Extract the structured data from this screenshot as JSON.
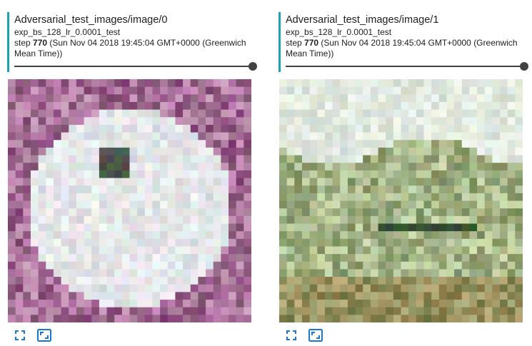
{
  "accent_color": "#1ba3b5",
  "cards": [
    {
      "title": "Adversarial_test_images/image/0",
      "run": "exp_bs_128_lr_0.0001_test",
      "step_prefix": "step ",
      "step_number": "770",
      "step_suffix": " (Sun Nov 04 2018 19:45:04 GMT+0000 (Greenwich Mean Time))",
      "slider_value": 1.0,
      "image_description": "pixelated white dog face",
      "icons": [
        "fullscreen-icon",
        "fit-to-window-icon"
      ]
    },
    {
      "title": "Adversarial_test_images/image/1",
      "run": "exp_bs_128_lr_0.0001_test",
      "step_prefix": "step ",
      "step_number": "770",
      "step_suffix": " (Sun Nov 04 2018 19:45:04 GMT+0000 (Greenwich Mean Time))",
      "slider_value": 1.0,
      "image_description": "pixelated horse on grass",
      "icons": [
        "fullscreen-icon",
        "fit-to-window-icon"
      ]
    }
  ]
}
